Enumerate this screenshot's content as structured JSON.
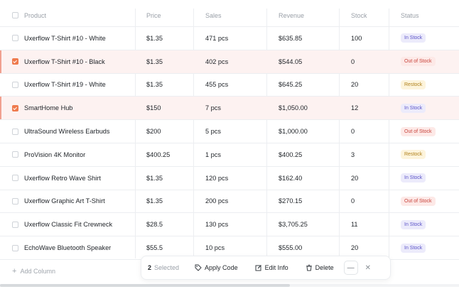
{
  "columns": [
    "Product",
    "Price",
    "Sales",
    "Revenue",
    "Stock",
    "Status"
  ],
  "status_styles": {
    "In Stock": {
      "bg": "#ecebfb",
      "fg": "#5b53c8"
    },
    "Out of Stock": {
      "bg": "#fde9e7",
      "fg": "#c8423a"
    },
    "Restock": {
      "bg": "#fdf4dc",
      "fg": "#b0801a"
    }
  },
  "rows": [
    {
      "product": "Uxerflow T-Shirt #10 - White",
      "price": "$1.35",
      "sales": "471 pcs",
      "revenue": "$635.85",
      "stock": "100",
      "status": "In Stock",
      "selected": false
    },
    {
      "product": "Uxerflow T-Shirt #10 - Black",
      "price": "$1.35",
      "sales": "402 pcs",
      "revenue": "$544.05",
      "stock": "0",
      "status": "Out of Stock",
      "selected": true
    },
    {
      "product": "Uxerflow T-Shirt #19 - White",
      "price": "$1.35",
      "sales": "455 pcs",
      "revenue": "$645.25",
      "stock": "20",
      "status": "Restock",
      "selected": false
    },
    {
      "product": "SmartHome Hub",
      "price": "$150",
      "sales": "7 pcs",
      "revenue": "$1,050.00",
      "stock": "12",
      "status": "In Stock",
      "selected": true
    },
    {
      "product": "UltraSound Wireless Earbuds",
      "price": "$200",
      "sales": "5 pcs",
      "revenue": "$1,000.00",
      "stock": "0",
      "status": "Out of Stock",
      "selected": false
    },
    {
      "product": "ProVision 4K Monitor",
      "price": "$400.25",
      "sales": "1 pcs",
      "revenue": "$400.25",
      "stock": "3",
      "status": "Restock",
      "selected": false
    },
    {
      "product": "Uxerflow Retro Wave Shirt",
      "price": "$1.35",
      "sales": "120 pcs",
      "revenue": "$162.40",
      "stock": "20",
      "status": "In Stock",
      "selected": false
    },
    {
      "product": "Uxerflow Graphic Art T-Shirt",
      "price": "$1.35",
      "sales": "200 pcs",
      "revenue": "$270.15",
      "stock": "0",
      "status": "Out of Stock",
      "selected": false
    },
    {
      "product": "Uxerflow Classic Fit Crewneck",
      "price": "$28.5",
      "sales": "130 pcs",
      "revenue": "$3,705.25",
      "stock": "11",
      "status": "In Stock",
      "selected": false
    },
    {
      "product": "EchoWave Bluetooth Speaker",
      "price": "$55.5",
      "sales": "10 pcs",
      "revenue": "$555.00",
      "stock": "20",
      "status": "In Stock",
      "selected": false
    }
  ],
  "footer": {
    "add_column": "Add Column"
  },
  "action_bar": {
    "count": "2",
    "selected_label": "Selected",
    "apply_code": "Apply Code",
    "edit_info": "Edit Info",
    "delete": "Delete",
    "more_icon": "more-icon",
    "close_icon": "close-icon"
  }
}
